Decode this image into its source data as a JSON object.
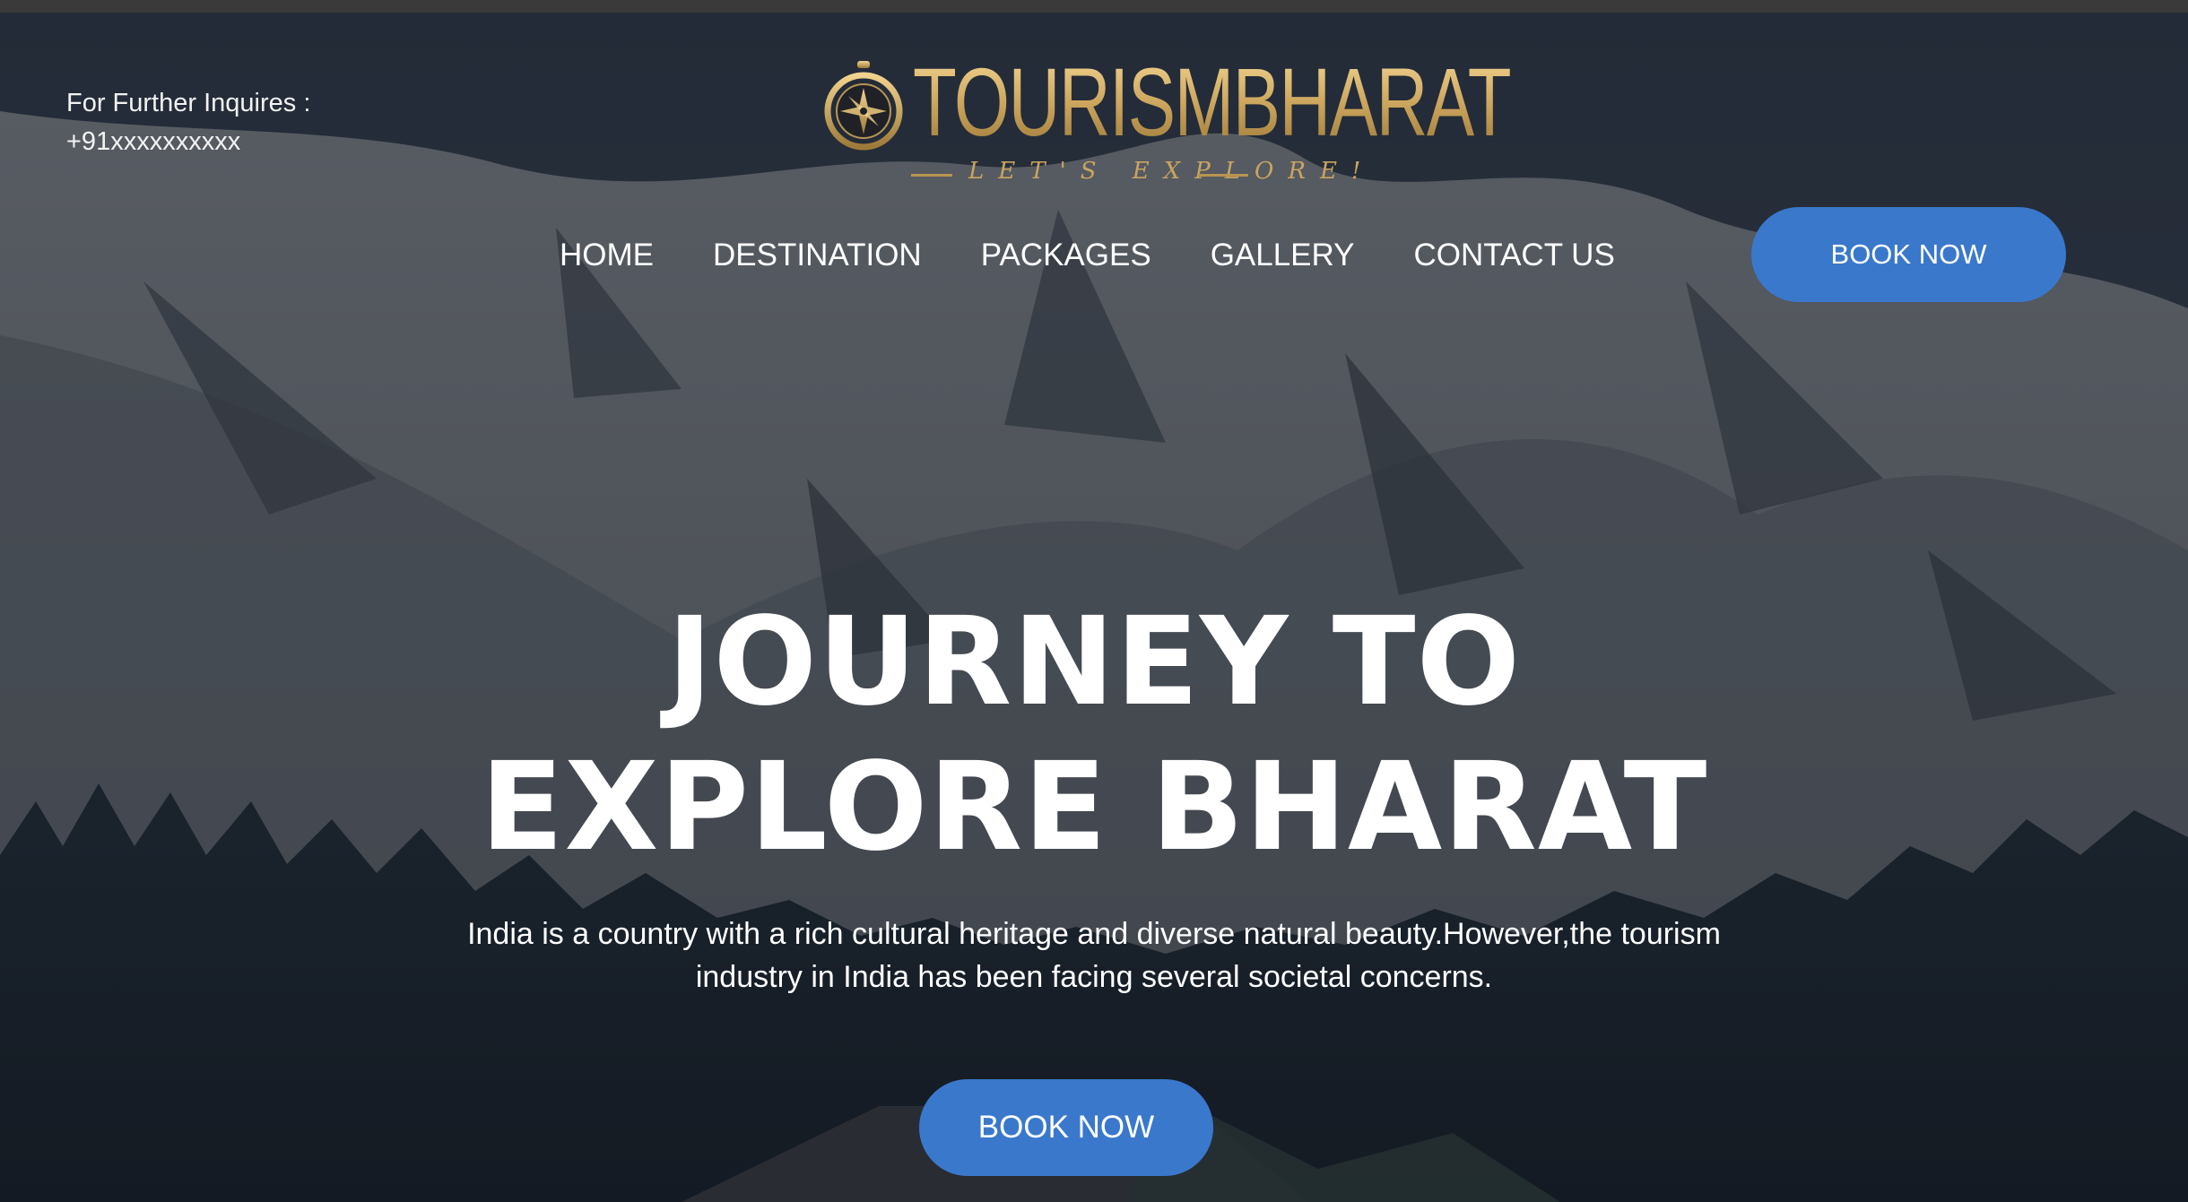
{
  "contact": {
    "label": "For Further Inquires :",
    "phone": "+91xxxxxxxxxx"
  },
  "logo": {
    "name": "TOURISMBHARAT",
    "tagline": "LET'S EXPLORE!"
  },
  "nav": {
    "items": [
      {
        "label": "HOME"
      },
      {
        "label": "DESTINATION"
      },
      {
        "label": "PACKAGES"
      },
      {
        "label": "GALLERY"
      },
      {
        "label": "CONTACT US"
      }
    ],
    "book_label": "BOOK NOW"
  },
  "hero": {
    "title_line1": "JOURNEY TO",
    "title_line2": "EXPLORE BHARAT",
    "description_line1": "India is a country with a rich cultural heritage and diverse natural beauty.However,the tourism",
    "description_line2": "industry in India has been facing several societal concerns.",
    "button_label": "BOOK NOW"
  },
  "colors": {
    "accent": "#3a78cc",
    "logo_gold": "#d7b86d",
    "text": "#ffffff"
  }
}
